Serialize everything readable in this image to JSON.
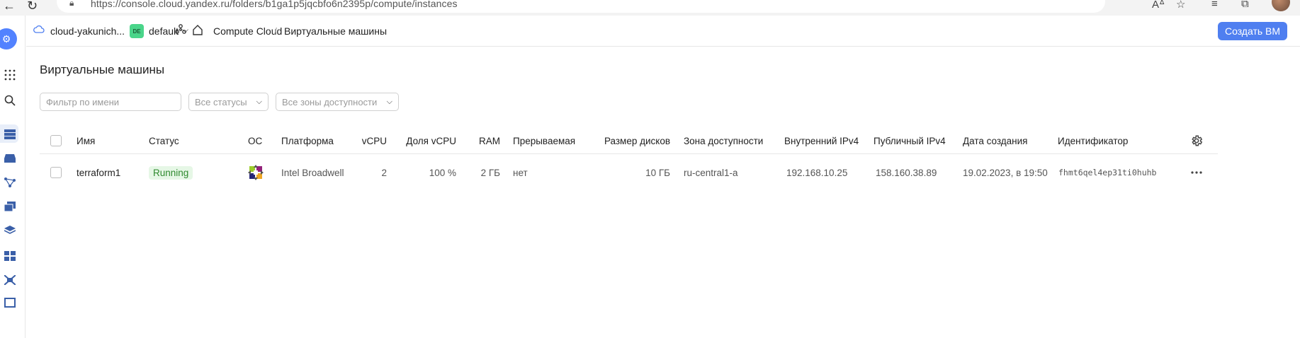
{
  "browser": {
    "url": "https://console.cloud.yandex.ru/folders/b1ga1p5jqcbfo6n2395p/compute/instances"
  },
  "header": {
    "cloud_name": "cloud-yakunich...",
    "folder_badge": "DE",
    "folder_name": "default",
    "breadcrumb_service": "Compute Cloud",
    "breadcrumb_separator": "/",
    "breadcrumb_page": "Виртуальные машины",
    "create_button": "Создать ВМ"
  },
  "page": {
    "title": "Виртуальные машины"
  },
  "filters": {
    "name_placeholder": "Фильтр по имени",
    "status_select": "Все статусы",
    "zone_select": "Все зоны доступности"
  },
  "table": {
    "columns": [
      "Имя",
      "Статус",
      "ОС",
      "Платформа",
      "vCPU",
      "Доля vCPU",
      "RAM",
      "Прерываемая",
      "Размер дисков",
      "Зона доступности",
      "Внутренний IPv4",
      "Публичный IPv4",
      "Дата создания",
      "Идентификатор"
    ],
    "rows": [
      {
        "name": "terraform1",
        "status": "Running",
        "os_icon": "centos-icon",
        "platform": "Intel Broadwell",
        "vcpu": "2",
        "vcpu_share": "100 %",
        "ram": "2 ГБ",
        "preemptible": "нет",
        "disk_size": "10 ГБ",
        "zone": "ru-central1-a",
        "internal_ipv4": "192.168.10.25",
        "public_ipv4": "158.160.38.89",
        "created": "19.02.2023, в 19:50",
        "id": "fhmt6qel4ep31ti0huhb"
      }
    ]
  },
  "colors": {
    "accent": "#4f7ff0",
    "status_running_bg": "#e6f7e6",
    "status_running_text": "#2f8a2f",
    "folder_badge_bg": "#4ad58a"
  }
}
